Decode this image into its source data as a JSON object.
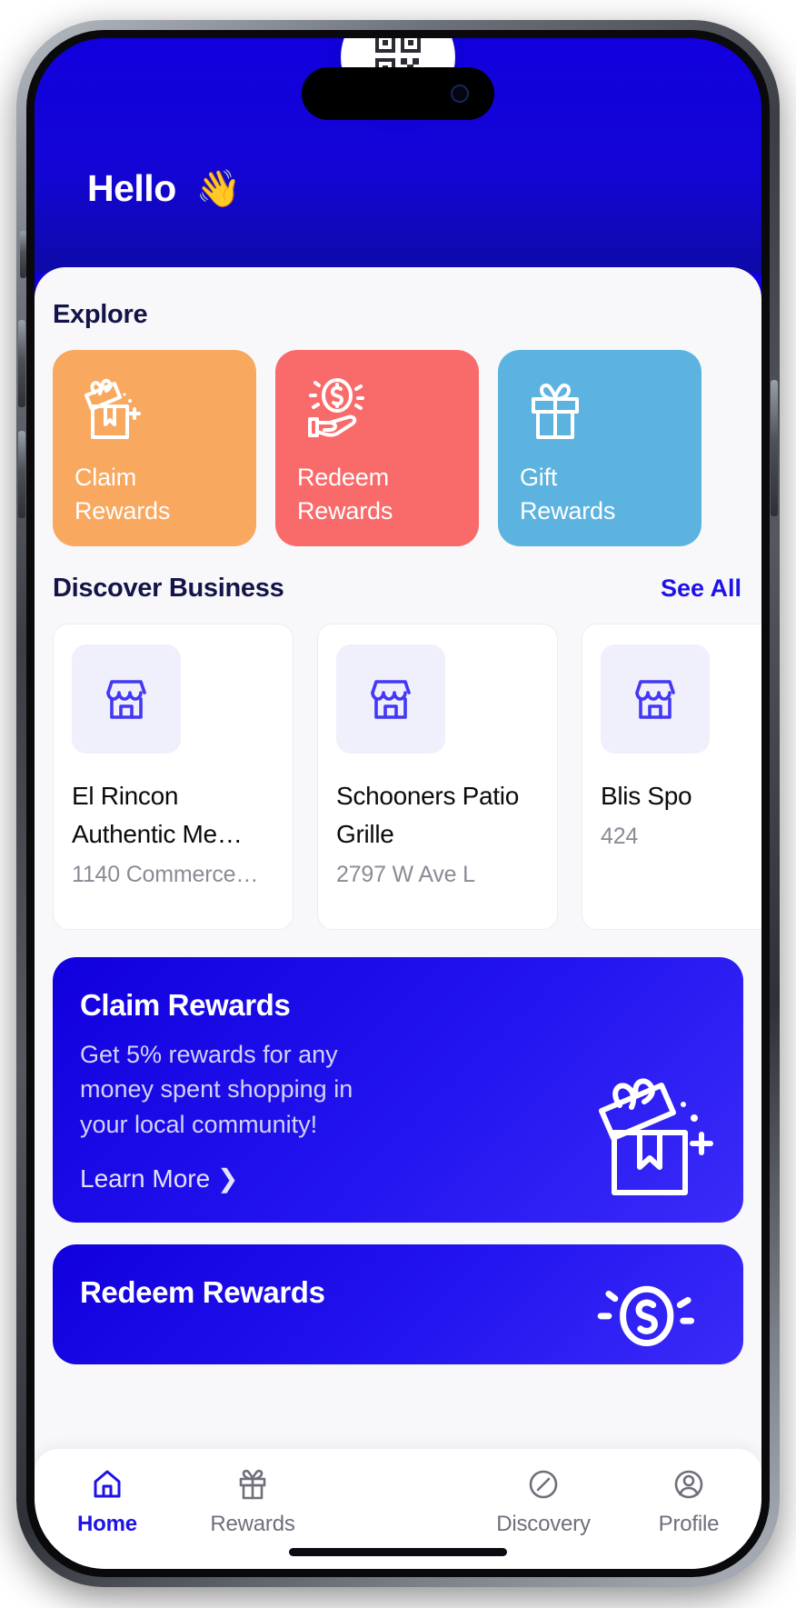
{
  "header": {
    "greeting": "Hello",
    "wave_emoji": "👋"
  },
  "explore": {
    "title": "Explore",
    "cards": [
      {
        "label": "Claim\nRewards",
        "label_line1": "Claim",
        "label_line2": "Rewards",
        "color": "#f9a85f",
        "icon": "gift-box-sparkle-icon"
      },
      {
        "label": "Redeem\nRewards",
        "label_line1": "Redeem",
        "label_line2": "Rewards",
        "color": "#f96a6a",
        "icon": "hand-coin-icon"
      },
      {
        "label": "Gift\nRewards",
        "label_line1": "Gift",
        "label_line2": "Rewards",
        "color": "#5cb3e0",
        "icon": "gift-icon"
      }
    ]
  },
  "discover": {
    "title": "Discover Business",
    "see_all": "See All",
    "businesses": [
      {
        "name": "El Rincon Authentic Me…",
        "address": "1140 Commerce…",
        "icon": "storefront-icon"
      },
      {
        "name": "Schooners Patio Grille",
        "address": "2797 W Ave L",
        "icon": "storefront-icon"
      },
      {
        "name": "Blis Spo",
        "address": "424",
        "icon": "storefront-icon"
      }
    ]
  },
  "promos": [
    {
      "title": "Claim Rewards",
      "body": "Get 5% rewards for any money spent shopping in your local community!",
      "cta": "Learn More  ❯",
      "art": "gift-box-sparkle-icon"
    },
    {
      "title": "Redeem Rewards",
      "body": "",
      "cta": "",
      "art": "hand-coin-icon"
    }
  ],
  "tabs": [
    {
      "label": "Home",
      "icon": "home-icon",
      "active": true
    },
    {
      "label": "Rewards",
      "icon": "gift-icon",
      "active": false
    },
    {
      "label": "Discovery",
      "icon": "compass-icon",
      "active": false
    },
    {
      "label": "Profile",
      "icon": "user-circle-icon",
      "active": false
    }
  ],
  "scan_button": {
    "icon": "qr-code-icon"
  },
  "colors": {
    "brand_blue": "#1100dd",
    "link_blue": "#1e12e6",
    "heading_navy": "#141449",
    "claim_orange": "#f9a85f",
    "redeem_red": "#f96a6a",
    "gift_blue": "#5cb3e0",
    "sheet_bg": "#f8f8fa",
    "muted_text": "#8b8b96"
  }
}
